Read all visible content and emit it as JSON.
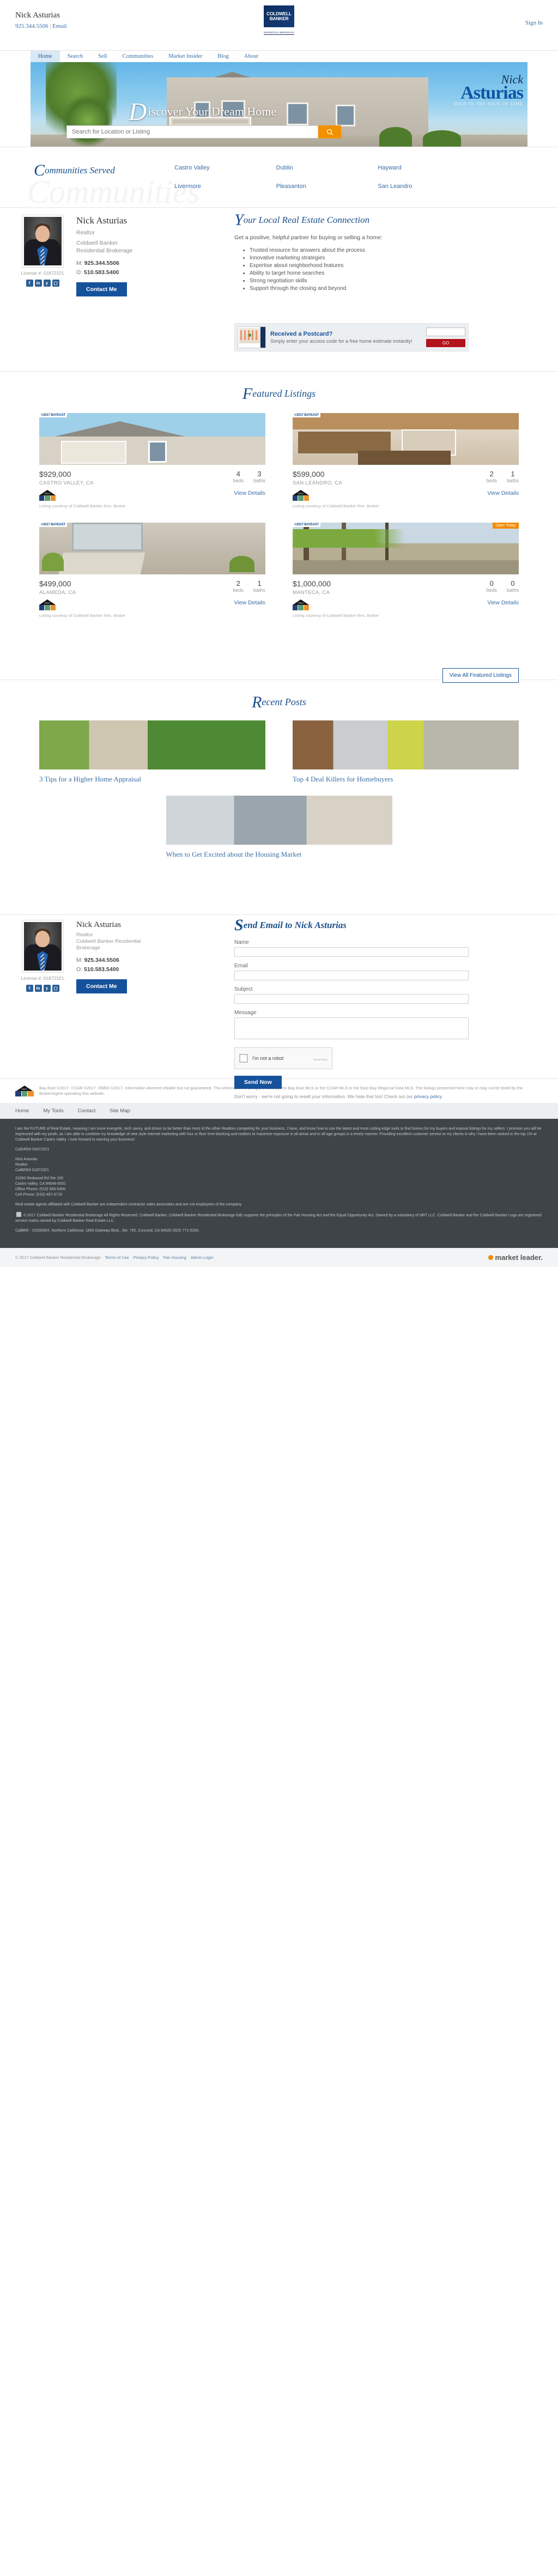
{
  "header": {
    "agent_name": "Nick Asturias",
    "phone": "925.344.5506",
    "separator": "|",
    "email_label": "Email",
    "brand_line1": "COLDWELL",
    "brand_line2": "BANKER",
    "brand_sub": "RESIDENTIAL BROKERAGE",
    "sign_in": "Sign In"
  },
  "nav": {
    "items": [
      {
        "label": "Home",
        "active": true
      },
      {
        "label": "Search",
        "active": false
      },
      {
        "label": "Sell",
        "active": false
      },
      {
        "label": "Communities",
        "active": false
      },
      {
        "label": "Market Insider",
        "active": false
      },
      {
        "label": "Blog",
        "active": false
      },
      {
        "label": "About",
        "active": false
      }
    ]
  },
  "hero": {
    "tagline_cap": "D",
    "tagline_rest": "iscover Your Dream Home",
    "search_placeholder": "Search for Location or Listing",
    "search_value": "",
    "search_icon": "search-icon",
    "logo_first": "Nick",
    "logo_last": "Asturias",
    "logo_tag": "SOLD IN THE NICK OF TIME"
  },
  "communities": {
    "title_cap": "C",
    "title_rest": "ommunities Served",
    "ghost": "Communities",
    "items": [
      "Castro Valley",
      "Dublin",
      "Hayward",
      "Livermore",
      "Pleasanton",
      "San Leandro"
    ]
  },
  "agent": {
    "name": "Nick Asturias",
    "role_lines": [
      "Realtor",
      "Coldwell Banker Residential Brokerage"
    ],
    "license": "License #: 01872321",
    "mobile_label": "M:",
    "mobile": "925.344.5506",
    "office_label": "O:",
    "office": "510.583.5400",
    "contact_button": "Contact Me",
    "socials": [
      "facebook-icon",
      "linkedin-icon",
      "yelp-icon",
      "instagram-icon"
    ]
  },
  "connection": {
    "title_cap": "Y",
    "title_mid": "our ",
    "title_em": "Local",
    "title_end": " Real Estate Connection",
    "intro": "Get a positive, helpful partner for buying or selling a home:",
    "bullets": [
      "Trusted resource for answers about the process",
      "Innovative marketing strategies",
      "Expertise about neighborhood features",
      "Ability to target home searches",
      "Strong negotiation skills",
      "Support through the closing and beyond"
    ]
  },
  "postcard": {
    "title": "Received a Postcard?",
    "text": "Simply enter your access code for a free home estimate instantly!",
    "input_value": "",
    "button": "GO"
  },
  "featured": {
    "title_cap": "F",
    "title_rest": "eatured Listings",
    "view_all": "View All Featured Listings",
    "view_details": "View Details",
    "courtesy": "Listing courtesy of Coldwell Banker Res. Broker",
    "beds_label": "beds",
    "baths_label": "baths",
    "mls_badge": "©2017 BAYEAST",
    "mls_year": "©2017",
    "listings": [
      {
        "price": "$929,000",
        "city": "CASTRO VALLEY, CA",
        "beds": "4",
        "baths": "3",
        "open": ""
      },
      {
        "price": "$599,000",
        "city": "SAN LEANDRO, CA",
        "beds": "2",
        "baths": "1",
        "open": ""
      },
      {
        "price": "$499,000",
        "city": "ALAMEDA, CA",
        "beds": "2",
        "baths": "1",
        "open": ""
      },
      {
        "price": "$1,000,000",
        "city": "MANTECA, CA",
        "beds": "0",
        "baths": "0",
        "open": "Open Today"
      }
    ]
  },
  "posts": {
    "title_cap": "R",
    "title_rest": "ecent Posts",
    "items": [
      {
        "title": "3 Tips for a Higher Home Appraisal"
      },
      {
        "title": "Top 4 Deal Killers for Homebuyers"
      },
      {
        "title": "When to Get Excited about the Housing Market"
      }
    ]
  },
  "contact": {
    "title_cap": "S",
    "title_rest": "end Email to Nick Asturias",
    "fields": [
      {
        "label": "Name",
        "value": ""
      },
      {
        "label": "Email",
        "value": ""
      },
      {
        "label": "Subject",
        "value": ""
      }
    ],
    "message_label": "Message",
    "message_value": "",
    "captcha_text": "I'm not a robot",
    "captcha_brand": "reCAPTCHA",
    "send_button": "Send Now",
    "privacy_note": "Don't worry - we're not going to resell your information. We hate that too! Check out our",
    "privacy_link": "privacy policy"
  },
  "disclaimer": {
    "text": "Bay East ©2017. CCAR ©2017. EBRD ©2017. Information deemed reliable but not guaranteed. This information is being provided by the Bay East MLS or the CCAR MLS or the East Bay Regional Data MLS. The listings presented here may or may not be listed by the Broker/Agent operating this website."
  },
  "footer_nav": {
    "items": [
      "Home",
      "My Tools",
      "Contact",
      "Site Map"
    ]
  },
  "dark_footer": {
    "p1": "I am the FUTURE of Real Estate, meaning I am more energetic, tech savvy, and driven to be better than most of the other Realtors competing for your business. I have, and know how to use the latest and most cutting edge tools to find homes for my buyers and expose listings for my sellers. I promise you will be impressed with my youth, as I am able to combine my knowledge of new style internet marketing with four or floor time blocking and realtors to maximize exposure in all areas and to all age groups in a timely manner. Providing excellent customer service to my clients is why I have been ranked in the top 1% at Coldwell Banker Castro Valley. I look forward to earning your business!",
    "lic_label": "CalDRE# 01872321",
    "name": "Nick Asturias",
    "role": "Realtor",
    "company": "CalBRE# 01872321",
    "addr1": "21060 Redwood Rd Ste 100",
    "addr2": "Castro Valley, CA 94546-5551",
    "addr3": "Office Phone: (510) 583-5400",
    "addr4": "Cell Phone: (510) 457-3719",
    "p2": "Real estate agents affiliated with Coldwell Banker are independent contractor sales associates and are not employees of the company.",
    "p3": "© 2017 Coldwell Banker Residential Brokerage All Rights Reserved. Coldwell Banker, Coldwell Banker Residential Brokerage fully supports the principles of the Fair Housing Act and the Equal Opportunity Act. Owned by a subsidiary of NRT LLC. Coldwell Banker and the Coldwell Banker Logo are registered service marks owned by Coldwell Banker Real Estate LLC.",
    "p4": "CalBRE - 01908304. Northern California: 1855 Gateway Blvd., Ste. 750, Concord, CA 94520 (925) 771-5200."
  },
  "bottom": {
    "copyright": "© 2017 Coldwell Banker Residential Brokerage",
    "links": [
      "Terms of Use",
      "Privacy Policy",
      "Fair Housing",
      "Admin Login"
    ],
    "powered_by": "market leader."
  },
  "colors": {
    "brand_blue": "#16529b",
    "link_blue": "#3a6ea5",
    "accent_orange": "#f29100",
    "dark_footer": "#3f4448"
  }
}
